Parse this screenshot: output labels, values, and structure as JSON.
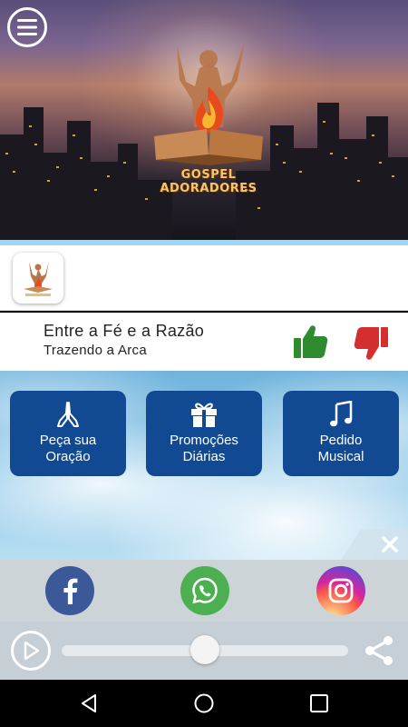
{
  "header": {
    "logo_text": "GOSPEL ADORADORES",
    "menu_icon": "hamburger-menu-icon"
  },
  "station": {
    "thumb_caption": "GOSPEL ADORADORES"
  },
  "now_playing": {
    "title": "Entre a Fé e a Razão",
    "artist": "Trazendo a Arca",
    "like_color": "#2e8b2e",
    "dislike_color": "#d32f2f"
  },
  "actions": [
    {
      "label_line1": "Peça sua",
      "label_line2": "Oração",
      "icon": "praying-hands-icon"
    },
    {
      "label_line1": "Promoções",
      "label_line2": "Diárias",
      "icon": "gift-icon"
    },
    {
      "label_line1": "Pedido",
      "label_line2": "Musical",
      "icon": "music-note-icon"
    }
  ],
  "social": [
    {
      "name": "facebook",
      "icon": "facebook-icon"
    },
    {
      "name": "whatsapp",
      "icon": "whatsapp-icon"
    },
    {
      "name": "instagram",
      "icon": "instagram-icon"
    }
  ],
  "player": {
    "progress": 0.5
  },
  "colors": {
    "button_blue": "#114a92",
    "accent_light_blue": "#9fd6f0"
  }
}
